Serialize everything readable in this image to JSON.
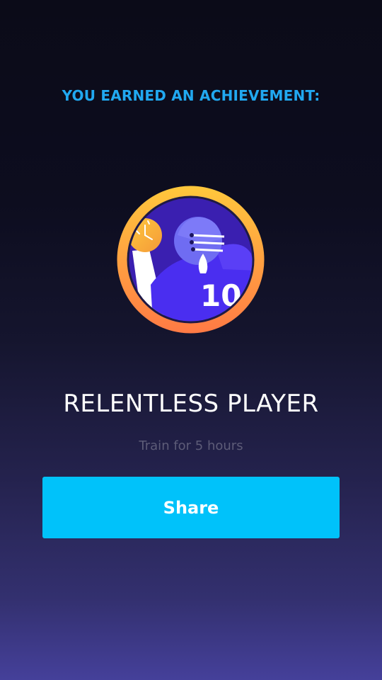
{
  "achievement": {
    "header": "YOU EARNED AN ACHIEVEMENT:",
    "title": "RELENTLESS PLAYER",
    "description": "Train for 5 hours",
    "badge_icon": "football-player-badge-icon",
    "jersey_number": "10"
  },
  "actions": {
    "share_label": "Share"
  },
  "colors": {
    "header": "#21a8f0",
    "share_button": "#00c2fa",
    "badge_ring_start": "#ffc83c",
    "badge_ring_end": "#ff7a45",
    "badge_background": "#3a1fb0"
  }
}
